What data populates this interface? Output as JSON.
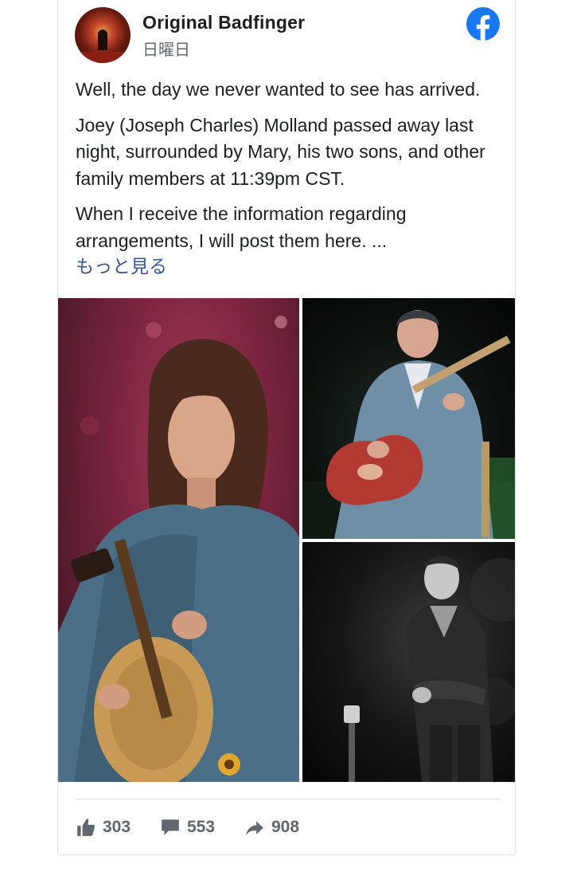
{
  "post": {
    "page_name": "Original Badfinger",
    "date": "日曜日",
    "paragraphs": [
      "Well, the day we never wanted to see has arrived.",
      "Joey (Joseph Charles) Molland passed away last night, surrounded by Mary, his two sons, and other family members at 11:39pm CST.",
      "When I receive the information regarding arrangements, I will post them here. ..."
    ],
    "see_more": "もっと見る"
  },
  "photos": [
    {
      "name": "young-guitarist-photo"
    },
    {
      "name": "older-guitarist-on-stage-photo"
    },
    {
      "name": "black-and-white-portrait-photo"
    }
  ],
  "stats": {
    "likes": "303",
    "comments": "553",
    "shares": "908"
  },
  "colors": {
    "facebook_blue": "#1877f2",
    "link": "#385898",
    "secondary_text": "#606770"
  }
}
